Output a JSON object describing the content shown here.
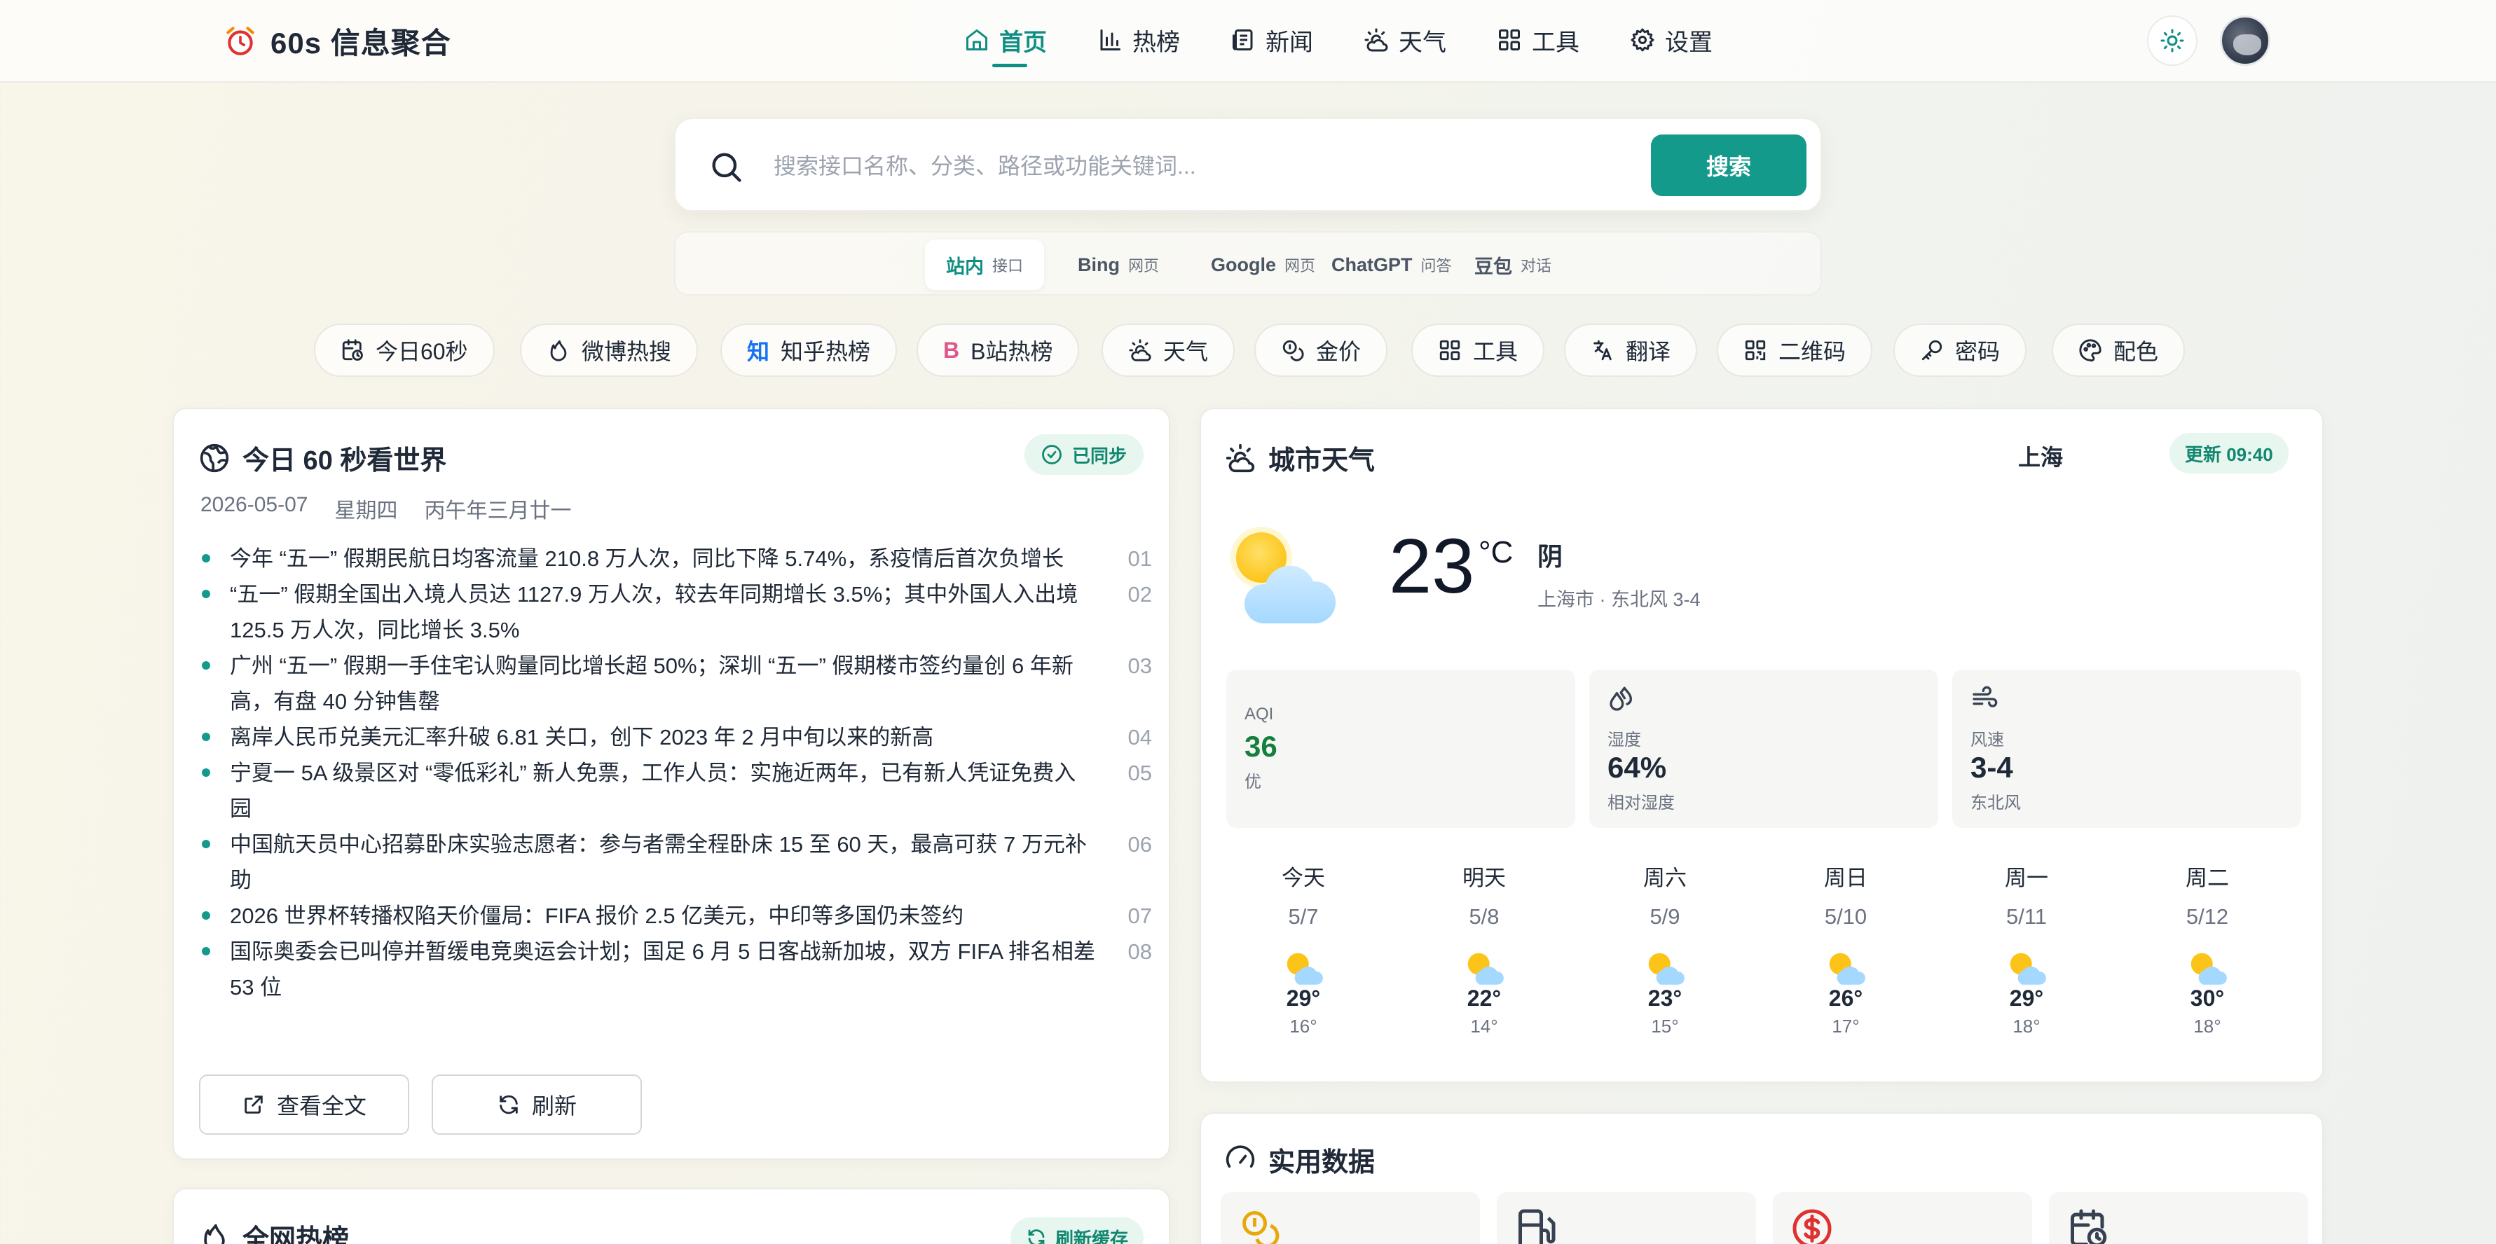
{
  "brand": {
    "title": "60s 信息聚合",
    "icon": "alarm-clock-icon"
  },
  "nav": [
    {
      "label": "首页",
      "icon": "home-icon",
      "active": true
    },
    {
      "label": "热榜",
      "icon": "bar-chart-icon"
    },
    {
      "label": "新闻",
      "icon": "newspaper-icon"
    },
    {
      "label": "天气",
      "icon": "sun-cloud-icon"
    },
    {
      "label": "工具",
      "icon": "grid-icon"
    },
    {
      "label": "设置",
      "icon": "gear-icon"
    }
  ],
  "search": {
    "placeholder": "搜索接口名称、分类、路径或功能关键词...",
    "button": "搜索",
    "engines": [
      {
        "name": "站内",
        "sub": "接口",
        "active": true
      },
      {
        "name": "Bing",
        "sub": "网页"
      },
      {
        "name": "Google",
        "sub": "网页"
      },
      {
        "name": "ChatGPT",
        "sub": "问答"
      },
      {
        "name": "豆包",
        "sub": "对话"
      }
    ]
  },
  "quick_links": [
    {
      "label": "今日60秒",
      "icon": "calendar-clock-icon"
    },
    {
      "label": "微博热搜",
      "icon": "flame-icon"
    },
    {
      "label": "知乎热榜",
      "glyph": "知",
      "glyph_color": "#1772f6"
    },
    {
      "label": "B站热榜",
      "glyph": "B",
      "glyph_color": "#e0578a"
    },
    {
      "label": "天气",
      "icon": "sun-cloud-icon"
    },
    {
      "label": "金价",
      "icon": "coins-icon"
    },
    {
      "label": "工具",
      "icon": "grid-icon"
    },
    {
      "label": "翻译",
      "icon": "translate-icon"
    },
    {
      "label": "二维码",
      "icon": "qrcode-icon"
    },
    {
      "label": "密码",
      "icon": "key-icon"
    },
    {
      "label": "配色",
      "icon": "palette-icon"
    }
  ],
  "news": {
    "title": "今日 60 秒看世界",
    "status": "已同步",
    "date": "2026-05-07",
    "weekday": "星期四",
    "lunar": "丙午年三月廿一",
    "items": [
      {
        "text": "今年 “五一” 假期民航日均客流量 210.8 万人次，同比下降 5.74%，系疫情后首次负增长",
        "num": "01"
      },
      {
        "text": "“五一” 假期全国出入境人员达 1127.9 万人次，较去年同期增长 3.5%；其中外国人入出境 125.5 万人次，同比增长 3.5%",
        "num": "02"
      },
      {
        "text": "广州 “五一” 假期一手住宅认购量同比增长超 50%；深圳 “五一” 假期楼市签约量创 6 年新高，有盘 40 分钟售罄",
        "num": "03"
      },
      {
        "text": "离岸人民币兑美元汇率升破 6.81 关口，创下 2023 年 2 月中旬以来的新高",
        "num": "04"
      },
      {
        "text": "宁夏一 5A 级景区对 “零低彩礼” 新人免票，工作人员：实施近两年，已有新人凭证免费入园",
        "num": "05"
      },
      {
        "text": "中国航天员中心招募卧床实验志愿者：参与者需全程卧床 15 至 60 天，最高可获 7 万元补助",
        "num": "06"
      },
      {
        "text": "2026 世界杯转播权陷天价僵局：FIFA 报价 2.5 亿美元，中印等多国仍未签约",
        "num": "07"
      },
      {
        "text": "国际奥委会已叫停并暂缓电竞奥运会计划；国足 6 月 5 日客战新加坡，双方 FIFA 排名相差 53 位",
        "num": "08"
      }
    ],
    "view_all": "查看全文",
    "refresh": "刷新"
  },
  "hot": {
    "title": "全网热榜",
    "refresh_cache": "刷新缓存"
  },
  "weather": {
    "title": "城市天气",
    "city": "上海",
    "updated": "更新 09:40",
    "temp": "23",
    "unit": "°C",
    "condition": "阴",
    "location_wind": "上海市 · 东北风 3-4",
    "metrics": [
      {
        "label": "AQI",
        "value": "36",
        "sub": "优",
        "value_color": "#15803d"
      },
      {
        "label": "湿度",
        "value": "64%",
        "sub": "相对湿度",
        "icon": "droplets-icon"
      },
      {
        "label": "风速",
        "value": "3-4",
        "sub": "东北风",
        "icon": "wind-icon"
      }
    ],
    "forecast": [
      {
        "day": "今天",
        "date": "5/7",
        "high": "29°",
        "low": "16°"
      },
      {
        "day": "明天",
        "date": "5/8",
        "high": "22°",
        "low": "14°"
      },
      {
        "day": "周六",
        "date": "5/9",
        "high": "23°",
        "low": "15°"
      },
      {
        "day": "周日",
        "date": "5/10",
        "high": "26°",
        "low": "17°"
      },
      {
        "day": "周一",
        "date": "5/11",
        "high": "29°",
        "low": "18°"
      },
      {
        "day": "周二",
        "date": "5/12",
        "high": "30°",
        "low": "18°"
      }
    ]
  },
  "utility": {
    "title": "实用数据",
    "tiles": [
      "coins-icon",
      "fuel-pump-icon",
      "dollar-circle-icon",
      "calendar-clock-icon"
    ]
  },
  "colors": {
    "accent": "#139a8a",
    "accent_dark": "#0f8f83",
    "badge_bg": "#e7f6ef",
    "sun": "#fcc419",
    "cloud": "#a5d8ff"
  }
}
